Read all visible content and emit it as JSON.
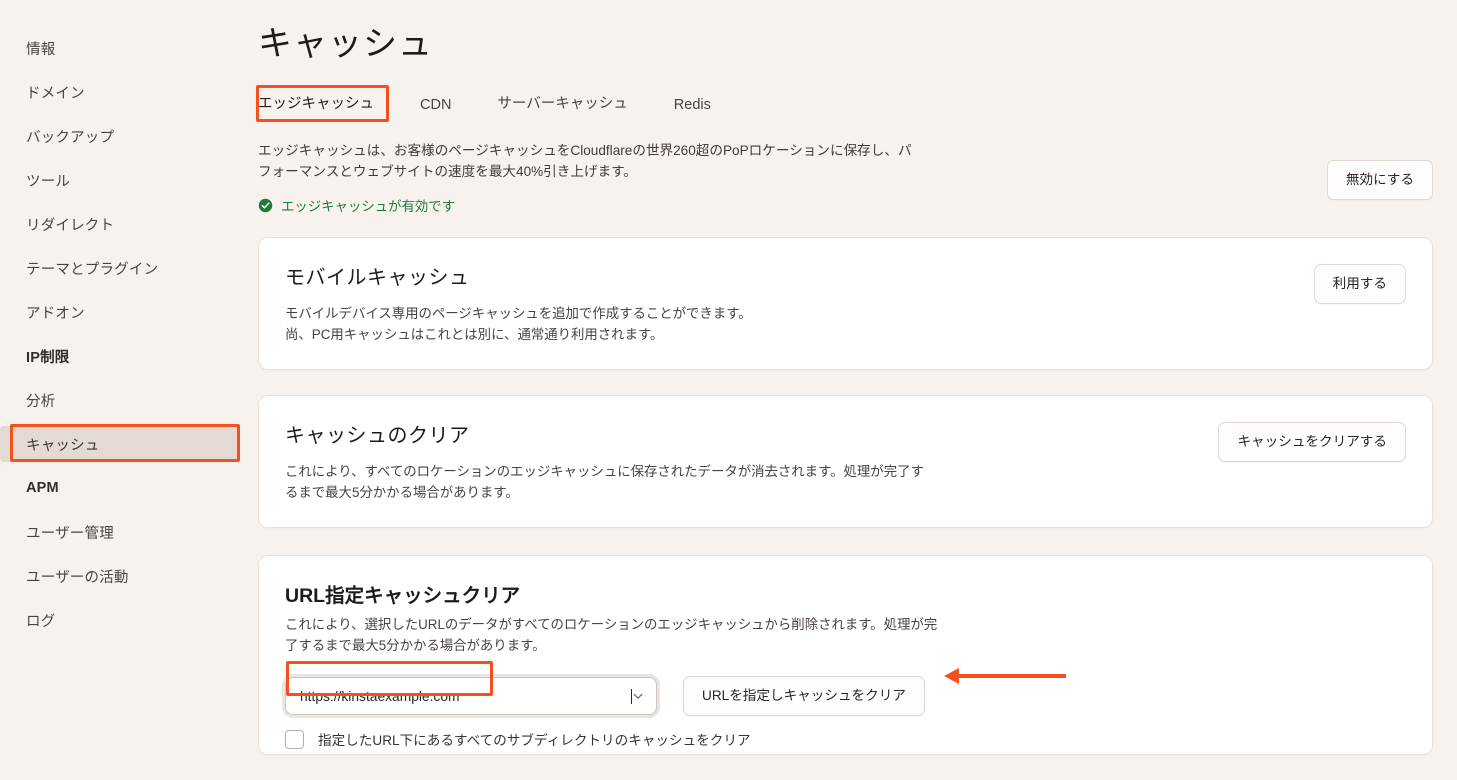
{
  "colors": {
    "page_bg": "#F8F2EF",
    "card_bg": "#FFFFFF",
    "accent_annotation": "#F4511E",
    "status_green": "#1F7A3D",
    "sidebar_active_bg": "#E3DAD3"
  },
  "sidebar": {
    "items": [
      {
        "label": "情報",
        "active": false,
        "bold": false
      },
      {
        "label": "ドメイン",
        "active": false,
        "bold": false
      },
      {
        "label": "バックアップ",
        "active": false,
        "bold": false
      },
      {
        "label": "ツール",
        "active": false,
        "bold": false
      },
      {
        "label": "リダイレクト",
        "active": false,
        "bold": false
      },
      {
        "label": "テーマとプラグイン",
        "active": false,
        "bold": false
      },
      {
        "label": "アドオン",
        "active": false,
        "bold": false
      },
      {
        "label": "IP制限",
        "active": false,
        "bold": true
      },
      {
        "label": "分析",
        "active": false,
        "bold": false
      },
      {
        "label": "キャッシュ",
        "active": true,
        "bold": false
      },
      {
        "label": "APM",
        "active": false,
        "bold": true
      },
      {
        "label": "ユーザー管理",
        "active": false,
        "bold": false
      },
      {
        "label": "ユーザーの活動",
        "active": false,
        "bold": false
      },
      {
        "label": "ログ",
        "active": false,
        "bold": false
      }
    ]
  },
  "page": {
    "title": "キャッシュ"
  },
  "tabs": [
    {
      "label": "エッジキャッシュ",
      "active": true
    },
    {
      "label": "CDN",
      "active": false
    },
    {
      "label": "サーバーキャッシュ",
      "active": false
    },
    {
      "label": "Redis",
      "active": false
    }
  ],
  "edge_cache": {
    "description": "エッジキャッシュは、お客様のページキャッシュをCloudflareの世界260超のPoPロケーションに保存し、パフォーマンスとウェブサイトの速度を最大40%引き上げます。",
    "status_text": "エッジキャッシュが有効です",
    "status_icon": "check-circle-icon",
    "disable_button": "無効にする"
  },
  "cards": {
    "mobile_cache": {
      "title": "モバイルキャッシュ",
      "description": "モバイルデバイス専用のページキャッシュを追加で作成することができます。\n尚、PC用キャッシュはこれとは別に、通常通り利用されます。",
      "action_label": "利用する"
    },
    "clear_cache": {
      "title": "キャッシュのクリア",
      "description": "これにより、すべてのロケーションのエッジキャッシュに保存されたデータが消去されます。処理が完了するまで最大5分かかる場合があります。",
      "action_label": "キャッシュをクリアする"
    },
    "url_cache": {
      "title": "URL指定キャッシュクリア",
      "description": "これにより、選択したURLのデータがすべてのロケーションのエッジキャッシュから削除されます。処理が完了するまで最大5分かかる場合があります。",
      "url_value": "https://kinstaexample.com",
      "url_placeholder": "https://kinstaexample.com",
      "dropdown_icon": "chevron-down-icon",
      "action_label": "URLを指定しキャッシュをクリア",
      "checkbox_label": "指定したURL下にあるすべてのサブディレクトリのキャッシュをクリア",
      "checkbox_checked": false
    }
  },
  "annotations": {
    "sidebar_highlight": "キャッシュ",
    "tab_highlight": "エッジキャッシュ",
    "input_highlight": "https://kinstaexample.com",
    "arrow_icon": "arrow-left-icon",
    "arrow_target": "URLを指定しキャッシュをクリア"
  }
}
